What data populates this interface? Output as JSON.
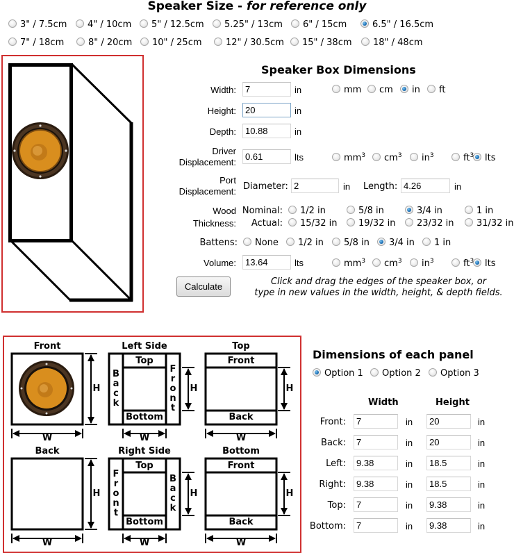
{
  "speaker_size": {
    "title_main": "Speaker Size - ",
    "title_italic": "for reference only",
    "options": [
      {
        "label": "3\" / 7.5cm",
        "selected": false
      },
      {
        "label": "4\" / 10cm",
        "selected": false
      },
      {
        "label": "5\" / 12.5cm",
        "selected": false
      },
      {
        "label": "5.25\" / 13cm",
        "selected": false
      },
      {
        "label": "6\" / 15cm",
        "selected": false
      },
      {
        "label": "6.5\" / 16.5cm",
        "selected": true
      },
      {
        "label": "7\" / 18cm",
        "selected": false
      },
      {
        "label": "8\" / 20cm",
        "selected": false
      },
      {
        "label": "10\" / 25cm",
        "selected": false
      },
      {
        "label": "12\" / 30.5cm",
        "selected": false
      },
      {
        "label": "15\" / 38cm",
        "selected": false
      },
      {
        "label": "18\" / 48cm",
        "selected": false
      }
    ]
  },
  "box": {
    "title": "Speaker Box Dimensions",
    "width": {
      "label": "Width:",
      "value": "7",
      "unit": "in"
    },
    "height": {
      "label": "Height:",
      "value": "20",
      "unit": "in"
    },
    "depth": {
      "label": "Depth:",
      "value": "10.88",
      "unit": "in"
    },
    "length_units": [
      {
        "label": "mm",
        "selected": false
      },
      {
        "label": "cm",
        "selected": false
      },
      {
        "label": "in",
        "selected": true
      },
      {
        "label": "ft",
        "selected": false
      }
    ],
    "driver": {
      "label_line1": "Driver",
      "label_line2": "Displacement:",
      "value": "0.61",
      "unit": "lts"
    },
    "volume_units": [
      {
        "label": "mm",
        "sup": "3",
        "selected": false
      },
      {
        "label": "cm",
        "sup": "3",
        "selected": false
      },
      {
        "label": "in",
        "sup": "3",
        "selected": false
      },
      {
        "label": "ft",
        "sup": "3",
        "selected": false
      },
      {
        "label": "lts",
        "sup": "",
        "selected": true
      }
    ],
    "port": {
      "label_line1": "Port",
      "label_line2": "Displacement:",
      "diameter_label": "Diameter:",
      "diameter": "2",
      "diameter_unit": "in",
      "length_label": "Length:",
      "length": "4.26",
      "length_unit": "in"
    },
    "wood": {
      "label_line1": "Wood",
      "label_line2": "Thickness:",
      "nominal_label": "Nominal:",
      "actual_label": "Actual:",
      "nominal": [
        {
          "label": "1/2 in",
          "selected": false
        },
        {
          "label": "5/8 in",
          "selected": false
        },
        {
          "label": "3/4 in",
          "selected": true
        },
        {
          "label": "1 in",
          "selected": false
        }
      ],
      "actual": [
        {
          "label": "15/32 in",
          "selected": false
        },
        {
          "label": "19/32 in",
          "selected": false
        },
        {
          "label": "23/32 in",
          "selected": false
        },
        {
          "label": "31/32 in",
          "selected": false
        }
      ]
    },
    "battens": {
      "label": "Battens:",
      "options": [
        {
          "label": "None",
          "selected": false
        },
        {
          "label": "1/2 in",
          "selected": false
        },
        {
          "label": "5/8 in",
          "selected": false
        },
        {
          "label": "3/4 in",
          "selected": true
        },
        {
          "label": "1 in",
          "selected": false
        }
      ]
    },
    "volume": {
      "label": "Volume:",
      "value": "13.64",
      "unit": "lts"
    },
    "calculate_label": "Calculate",
    "hint_line1": "Click and drag the edges of the speaker box, or",
    "hint_line2": "type in new values in the width, height, & depth fields."
  },
  "diagrams": {
    "front": "Front",
    "left_side": "Left Side",
    "top": "Top",
    "back": "Back",
    "right_side": "Right Side",
    "bottom": "Bottom",
    "w": "W",
    "h": "H",
    "lbl_top": "Top",
    "lbl_bottom": "Bottom",
    "lbl_front": "Front",
    "lbl_back": "Back",
    "vert_back": [
      "B",
      "a",
      "c",
      "k"
    ],
    "vert_front": [
      "F",
      "r",
      "o",
      "n",
      "t"
    ]
  },
  "panels": {
    "title": "Dimensions of each panel",
    "options": [
      {
        "label": "Option 1",
        "selected": true
      },
      {
        "label": "Option 2",
        "selected": false
      },
      {
        "label": "Option 3",
        "selected": false
      }
    ],
    "col_width": "Width",
    "col_height": "Height",
    "unit": "in",
    "rows": [
      {
        "name": "Front:",
        "width": "7",
        "height": "20"
      },
      {
        "name": "Back:",
        "width": "7",
        "height": "20"
      },
      {
        "name": "Left:",
        "width": "9.38",
        "height": "18.5"
      },
      {
        "name": "Right:",
        "width": "9.38",
        "height": "18.5"
      },
      {
        "name": "Top:",
        "width": "7",
        "height": "9.38"
      },
      {
        "name": "Bottom:",
        "width": "7",
        "height": "9.38"
      }
    ]
  }
}
